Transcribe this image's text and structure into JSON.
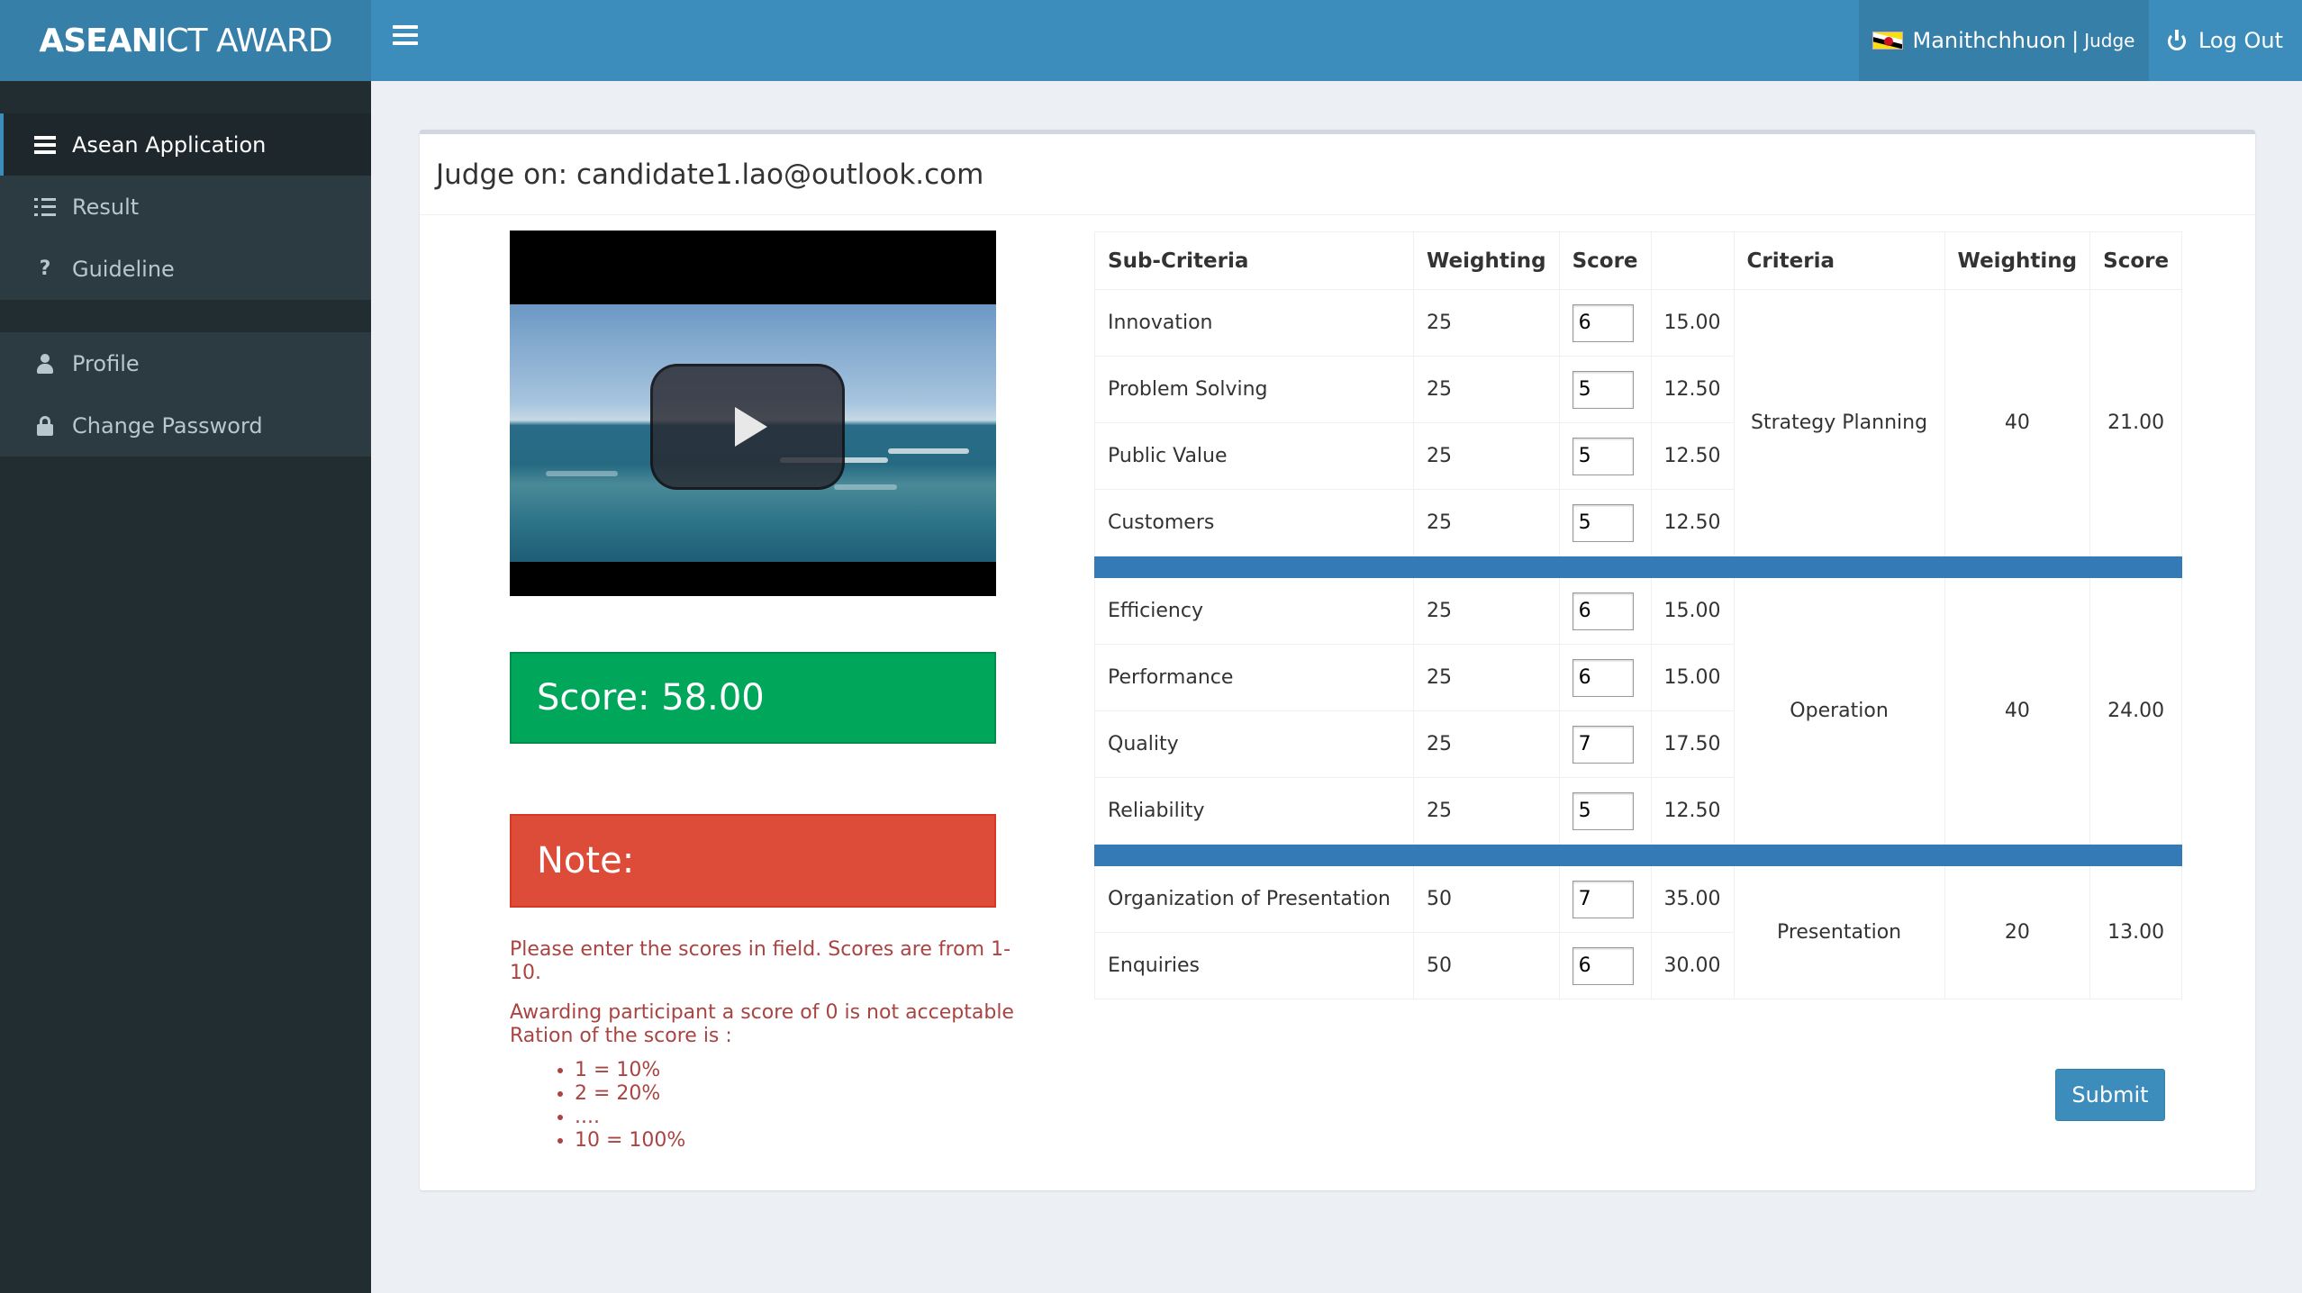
{
  "header": {
    "logo_bold": "ASEAN",
    "logo_thin": "ICT AWARD",
    "user_name": "Manithchhuon",
    "user_separator": "|",
    "user_role": "Judge",
    "logout_label": "Log Out"
  },
  "sidebar": {
    "group1": [
      {
        "label": "Asean Application",
        "icon": "list-icon",
        "active": true
      },
      {
        "label": "Result",
        "icon": "list-ol-icon"
      },
      {
        "label": "Guideline",
        "icon": "question-icon"
      }
    ],
    "group2": [
      {
        "label": "Profile",
        "icon": "user-icon"
      },
      {
        "label": "Change Password",
        "icon": "lock-icon"
      }
    ]
  },
  "main": {
    "title": "Judge on: candidate1.lao@outlook.com",
    "score_label": "Score: 58.00",
    "note_label": "Note:",
    "instructions": {
      "line1": "Please enter the scores in field. Scores are from 1-10.",
      "line2": "Awarding participant a score of 0 is not acceptable",
      "line3": "Ration of the score is :",
      "ratios": [
        "1 = 10%",
        "2 = 20%",
        "....",
        "10 = 100%"
      ]
    },
    "submit_label": "Submit"
  },
  "table": {
    "headers": [
      "Sub-Criteria",
      "Weighting",
      "Score",
      "",
      "Criteria",
      "Weighting",
      "Score"
    ],
    "groups": [
      {
        "criteria": "Strategy Planning",
        "weighting": "40",
        "score": "21.00",
        "rows": [
          {
            "name": "Innovation",
            "weight": "25",
            "input": "6",
            "calc": "15.00"
          },
          {
            "name": "Problem Solving",
            "weight": "25",
            "input": "5",
            "calc": "12.50"
          },
          {
            "name": "Public Value",
            "weight": "25",
            "input": "5",
            "calc": "12.50"
          },
          {
            "name": "Customers",
            "weight": "25",
            "input": "5",
            "calc": "12.50"
          }
        ]
      },
      {
        "criteria": "Operation",
        "weighting": "40",
        "score": "24.00",
        "rows": [
          {
            "name": "Efficiency",
            "weight": "25",
            "input": "6",
            "calc": "15.00"
          },
          {
            "name": "Performance",
            "weight": "25",
            "input": "6",
            "calc": "15.00"
          },
          {
            "name": "Quality",
            "weight": "25",
            "input": "7",
            "calc": "17.50"
          },
          {
            "name": "Reliability",
            "weight": "25",
            "input": "5",
            "calc": "12.50"
          }
        ]
      },
      {
        "criteria": "Presentation",
        "weighting": "20",
        "score": "13.00",
        "rows": [
          {
            "name": "Organization of Presentation",
            "weight": "50",
            "input": "7",
            "calc": "35.00"
          },
          {
            "name": "Enquiries",
            "weight": "50",
            "input": "6",
            "calc": "30.00"
          }
        ]
      }
    ]
  },
  "colors": {
    "header": "#3c8dbc",
    "sidebar": "#222d32",
    "score_box": "#00a65a",
    "note_box": "#dd4b39",
    "separator": "#337ab7"
  }
}
